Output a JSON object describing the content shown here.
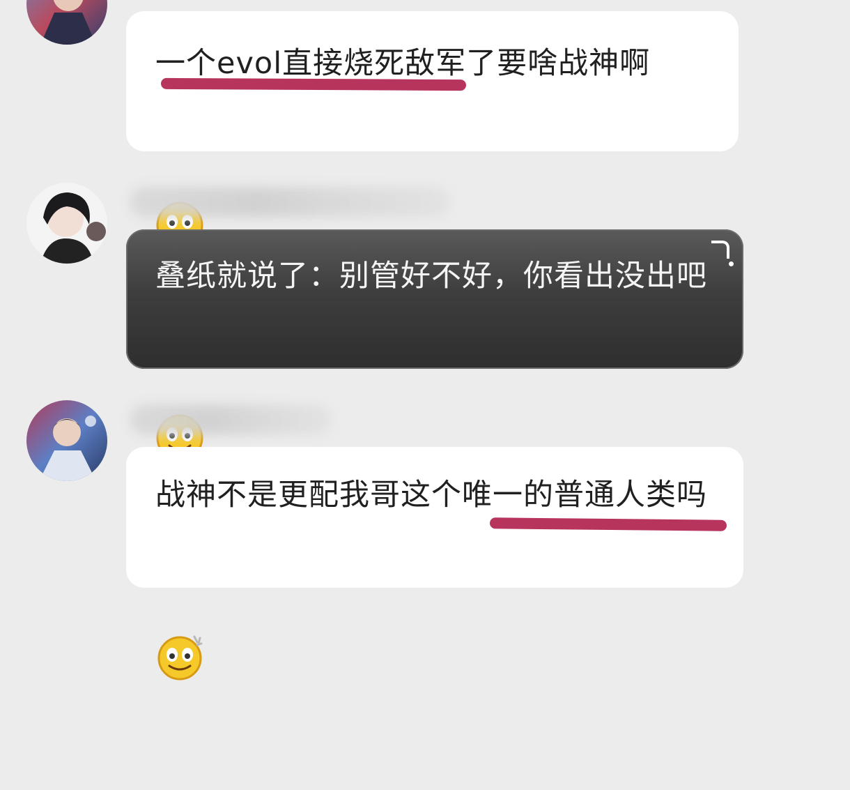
{
  "messages": [
    {
      "avatar_icon": "anime-character-avatar-icon",
      "text_part1": "一个evol直接烧死敌军了要啥战神啊",
      "emoji_icon": "smiling-face-emoji-icon",
      "bubble_style": "light",
      "underline_color": "#b7355d"
    },
    {
      "avatar_icon": "anime-character-avatar-icon",
      "text_part1": "叠纸就说了：别管好不好，你看出没出吧",
      "emoji_icon": "smiling-face-emoji-icon",
      "bubble_style": "dark"
    },
    {
      "avatar_icon": "anime-character-avatar-icon",
      "text_part1": "战神不是更配我哥这个唯一的普通人类吗",
      "emoji_icon": "smiling-face-emoji-icon",
      "bubble_style": "light",
      "underline_color": "#b7355d"
    }
  ]
}
